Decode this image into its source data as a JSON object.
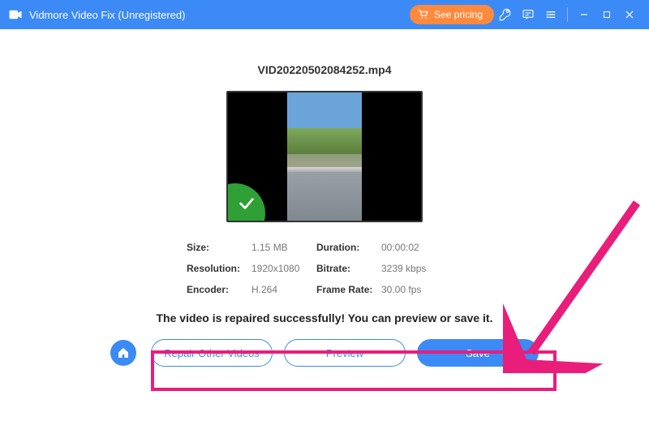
{
  "titlebar": {
    "app_name": "Vidmore Video Fix (Unregistered)",
    "see_pricing": "See pricing"
  },
  "file": {
    "name": "VID20220502084252.mp4"
  },
  "meta": {
    "size_label": "Size:",
    "size_value": "1.15 MB",
    "duration_label": "Duration:",
    "duration_value": "00:00:02",
    "resolution_label": "Resolution:",
    "resolution_value": "1920x1080",
    "bitrate_label": "Bitrate:",
    "bitrate_value": "3239 kbps",
    "encoder_label": "Encoder:",
    "encoder_value": "H.264",
    "framerate_label": "Frame Rate:",
    "framerate_value": "30.00 fps"
  },
  "status": {
    "message": "The video is repaired successfully! You can preview or save it."
  },
  "actions": {
    "repair_other": "Repair Other Videos",
    "preview": "Preview",
    "save": "Save"
  }
}
